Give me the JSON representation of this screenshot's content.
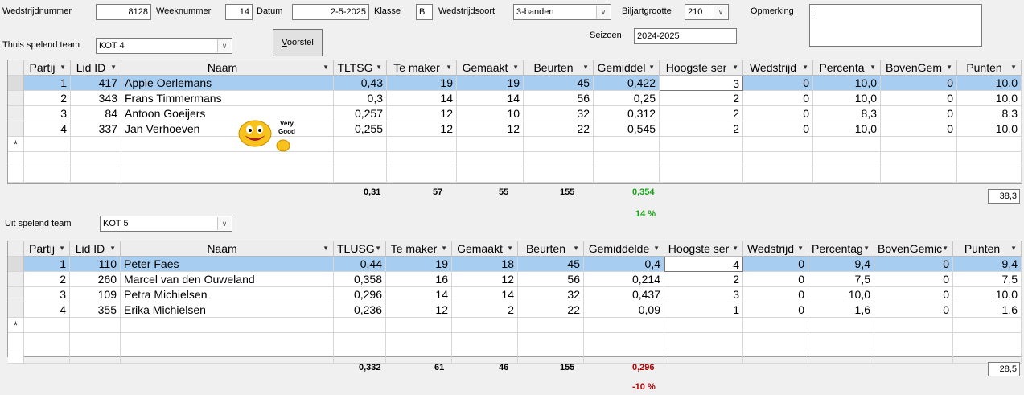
{
  "form": {
    "wedstrijdnummer": {
      "label": "Wedstrijdnummer",
      "value": "8128"
    },
    "weeknummer": {
      "label": "Weeknummer",
      "value": "14"
    },
    "datum": {
      "label": "Datum",
      "value": "2-5-2025"
    },
    "klasse": {
      "label": "Klasse",
      "value": "B"
    },
    "wedstrijdsoort": {
      "label": "Wedstrijdsoort",
      "value": "3-banden"
    },
    "biljartgrootte": {
      "label": "Biljartgrootte",
      "value": "210"
    },
    "opmerking": {
      "label": "Opmerking",
      "value": ""
    },
    "seizoen": {
      "label": "Seizoen",
      "value": "2024-2025"
    },
    "voorstel_button": {
      "accel": "V",
      "rest": "oorstel"
    },
    "thuis": {
      "label": "Thuis spelend team",
      "value": "KOT 4"
    },
    "uit": {
      "label": "Uit spelend team",
      "value": "KOT 5"
    }
  },
  "smiley": {
    "line1": "Very",
    "line2": "Good"
  },
  "home_grid": {
    "headers": [
      "Partij",
      "Lid ID",
      "Naam",
      "TLTSG",
      "Te maker",
      "Gemaakt",
      "Beurten",
      "Gemiddel",
      "Hoogste ser",
      "Wedstrijd",
      "Percenta",
      "BovenGem",
      "Punten"
    ],
    "rows": [
      [
        "1",
        "417",
        "Appie Oerlemans",
        "0,43",
        "19",
        "19",
        "45",
        "0,422",
        "3",
        "0",
        "10,0",
        "0",
        "10,0"
      ],
      [
        "2",
        "343",
        "Frans Timmermans",
        "0,3",
        "14",
        "14",
        "56",
        "0,25",
        "2",
        "0",
        "10,0",
        "0",
        "10,0"
      ],
      [
        "3",
        "84",
        "Antoon Goeijers",
        "0,257",
        "12",
        "10",
        "32",
        "0,312",
        "2",
        "0",
        "8,3",
        "0",
        "8,3"
      ],
      [
        "4",
        "337",
        "Jan Verhoeven",
        "0,255",
        "12",
        "12",
        "22",
        "0,545",
        "2",
        "0",
        "10,0",
        "0",
        "10,0"
      ]
    ],
    "new_row_marker": "*",
    "totals": {
      "tsg": "0,31",
      "te_maken": "57",
      "gemaakt": "55",
      "beurten": "155",
      "gemiddelde": "0,354",
      "percent": "14 %",
      "punten": "38,3"
    }
  },
  "away_grid": {
    "headers": [
      "Partij",
      "Lid ID",
      "Naam",
      "TLUSG",
      "Te maker",
      "Gemaakt",
      "Beurten",
      "Gemiddelde",
      "Hoogste ser",
      "Wedstrijd",
      "Percentag",
      "BovenGemic",
      "Punten"
    ],
    "rows": [
      [
        "1",
        "110",
        "Peter Faes",
        "0,44",
        "19",
        "18",
        "45",
        "0,4",
        "4",
        "0",
        "9,4",
        "0",
        "9,4"
      ],
      [
        "2",
        "260",
        "Marcel van den Ouweland",
        "0,358",
        "16",
        "12",
        "56",
        "0,214",
        "2",
        "0",
        "7,5",
        "0",
        "7,5"
      ],
      [
        "3",
        "109",
        "Petra Michielsen",
        "0,296",
        "14",
        "14",
        "32",
        "0,437",
        "3",
        "0",
        "10,0",
        "0",
        "10,0"
      ],
      [
        "4",
        "355",
        "Erika Michielsen",
        "0,236",
        "12",
        "2",
        "22",
        "0,09",
        "1",
        "0",
        "1,6",
        "0",
        "1,6"
      ]
    ],
    "new_row_marker": "*",
    "totals": {
      "tsg": "0,332",
      "te_maken": "61",
      "gemaakt": "46",
      "beurten": "155",
      "gemiddelde": "0,296",
      "percent": "-10 %",
      "punten": "28,5"
    }
  },
  "colors": {
    "positive": "#1aa31a",
    "negative": "#b00000",
    "selection": "#a7cdf0"
  }
}
